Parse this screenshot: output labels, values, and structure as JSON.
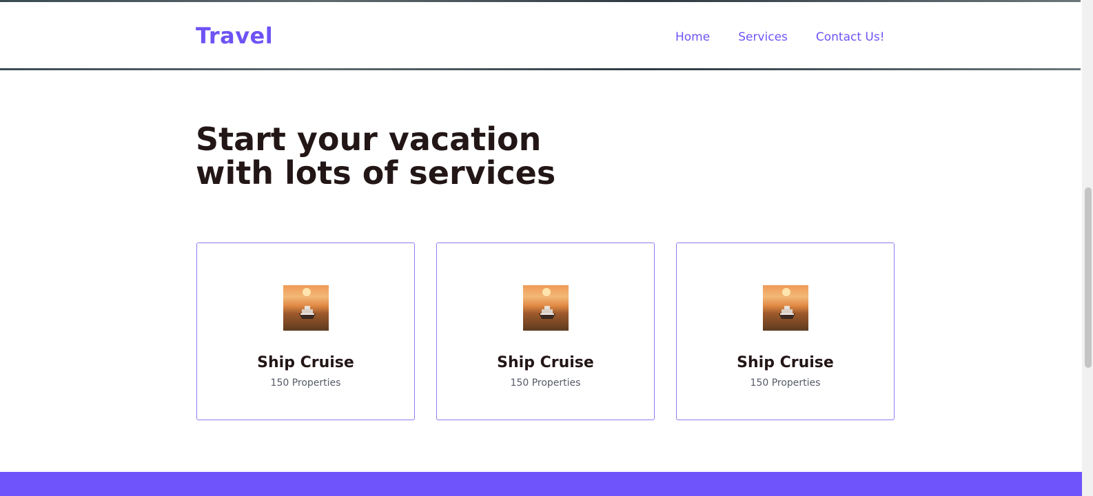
{
  "brand": "Travel",
  "nav": {
    "home": "Home",
    "services": "Services",
    "contact": "Contact Us!"
  },
  "hero": {
    "line1": "Start your vacation",
    "line2": "with lots of services"
  },
  "cards": [
    {
      "title": "Ship Cruise",
      "subtitle": "150 Properties"
    },
    {
      "title": "Ship Cruise",
      "subtitle": "150 Properties"
    },
    {
      "title": "Ship Cruise",
      "subtitle": "150 Properties"
    }
  ],
  "colors": {
    "accent": "#6f53f5",
    "heading": "#231616",
    "footer": "#6f53fb"
  },
  "icons": {
    "card_image": "cruise-ship-sunset-photo"
  }
}
